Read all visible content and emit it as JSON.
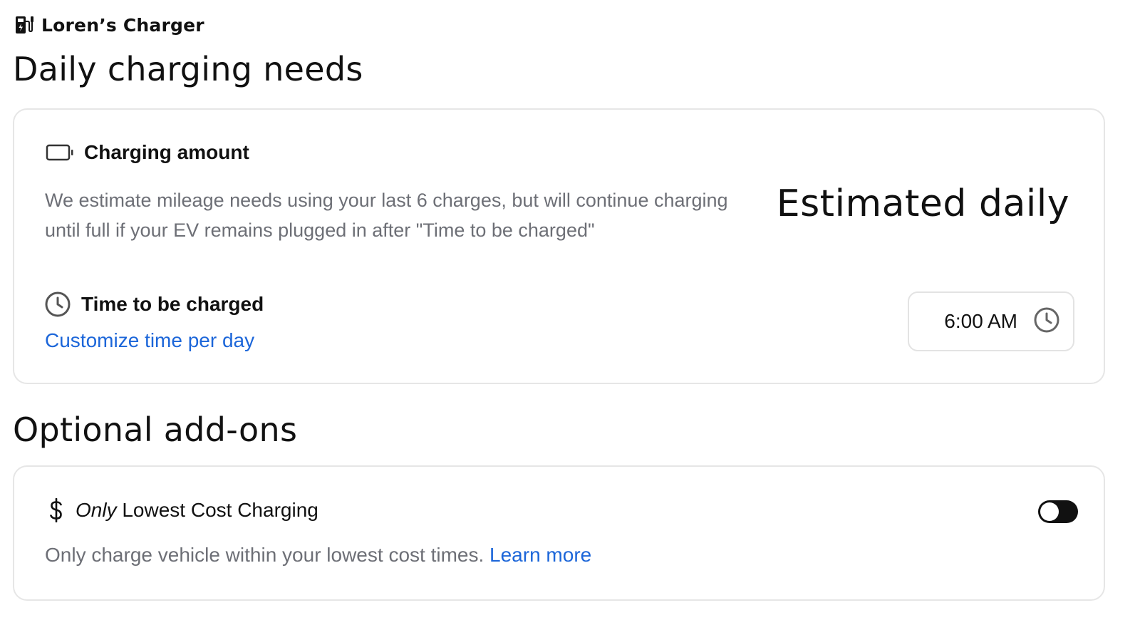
{
  "header": {
    "device_icon": "ev-charger-icon",
    "device_name": "Loren’s Charger"
  },
  "daily": {
    "title": "Daily charging needs",
    "charging_amount": {
      "icon": "battery-icon",
      "title": "Charging amount",
      "description": "We estimate mileage needs using your last 6 charges, but will continue charging until full if your EV remains plugged in after \"Time to be charged\"",
      "estimate_label": "Estimated daily"
    },
    "time_to_be_charged": {
      "icon": "clock-icon",
      "title": "Time to be charged",
      "customize_link": "Customize time per day",
      "time_value": "6:00 AM"
    }
  },
  "addons": {
    "title": "Optional add-ons",
    "lowest_cost": {
      "icon": "dollar-icon",
      "title_emphasis": "Only",
      "title_rest": "Lowest Cost Charging",
      "description": "Only charge vehicle within your lowest cost times.",
      "learn_more": "Learn more",
      "enabled": false
    }
  },
  "colors": {
    "link": "#1c66d9",
    "muted_text": "#6d6f76",
    "toggle_track": "#111111",
    "card_border": "#e6e6e6"
  }
}
